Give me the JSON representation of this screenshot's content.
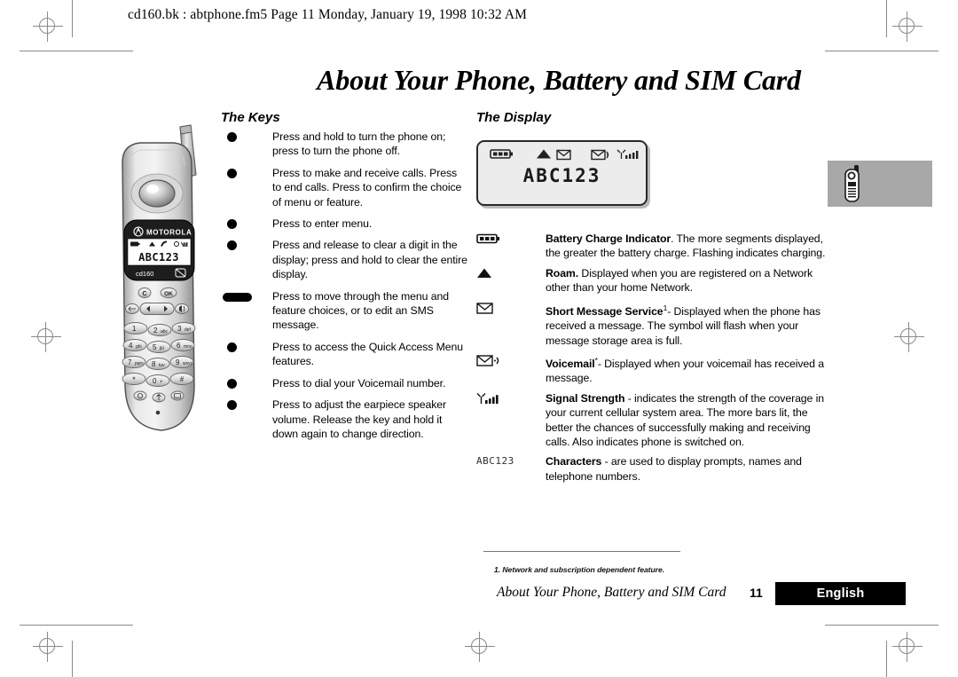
{
  "running_header": "cd160.bk : abtphone.fm5  Page 11  Monday, January 19, 1998  10:32 AM",
  "page_title": "About Your Phone, Battery and SIM Card",
  "sections": {
    "keys_heading": "The Keys",
    "display_heading": "The Display"
  },
  "keys": [
    {
      "bullet": "dot",
      "text": "Press and hold to turn the phone on; press to turn the phone off."
    },
    {
      "bullet": "dot",
      "text": "Press to make and receive calls. Press to end calls. Press to confirm the choice of menu or feature."
    },
    {
      "bullet": "dot",
      "text": "Press to enter menu."
    },
    {
      "bullet": "dot",
      "text": "Press and release to clear a digit in the display; press and hold to clear the entire display."
    },
    {
      "bullet": "pill",
      "text": "Press to move through the menu and feature choices, or to edit an SMS message."
    },
    {
      "bullet": "dot",
      "text": "Press to access the Quick Access Menu features."
    },
    {
      "bullet": "dot",
      "text": "Press to dial your Voicemail number."
    },
    {
      "bullet": "dot",
      "text": "Press to adjust the earpiece speaker volume. Release the key and hold it down again to change direction."
    }
  ],
  "lcd": {
    "text": "ABC123",
    "icons": [
      "battery-icon",
      "roam-triangle-icon",
      "envelope-icon",
      "voicemail-icon",
      "signal-strength-icon"
    ]
  },
  "phone": {
    "brand": "MOTOROLA",
    "model": "cd160",
    "screen_text": "ABC123",
    "keys": {
      "clear": "C",
      "ok": "OK",
      "row1": [
        "1",
        "2 abc",
        "3 def"
      ],
      "row2": [
        "4 ghi",
        "5 jkl",
        "6 mno"
      ],
      "row3": [
        "7 pqrs",
        "8 tuv",
        "9 wxyz"
      ],
      "row4": [
        "*",
        "0 +",
        "#"
      ]
    }
  },
  "legend": [
    {
      "icon": "battery-icon",
      "title": "Battery Charge Indicator",
      "body": ". The more segments displayed, the greater the battery charge. Flashing indicates charging."
    },
    {
      "icon": "roam-triangle-icon",
      "title": "Roam.",
      "body": " Displayed when you are registered on a Network other than your home Network."
    },
    {
      "icon": "envelope-icon",
      "title": "Short Message Service",
      "superscript": "1",
      "body": "- Displayed when the phone has received a message. The symbol will flash when your message storage area is full."
    },
    {
      "icon": "voicemail-icon",
      "title": "Voicemail",
      "superscript": "*",
      "body": "- Displayed when your voicemail has received a message."
    },
    {
      "icon": "signal-strength-icon",
      "title": "Signal Strength",
      "body": " - indicates the strength of the coverage in your current cellular system area. The more bars lit, the better the chances of successfully making and receiving calls. Also indicates phone is switched on."
    },
    {
      "icon": "characters-abc123",
      "icon_text": "ABC123",
      "title": "Characters",
      "body": " - are used to display prompts, names and telephone numbers."
    }
  ],
  "footnote": "1.  Network and subscription dependent feature.",
  "footer": {
    "title": "About Your Phone, Battery and SIM Card",
    "page_number": "11",
    "language": "English"
  }
}
